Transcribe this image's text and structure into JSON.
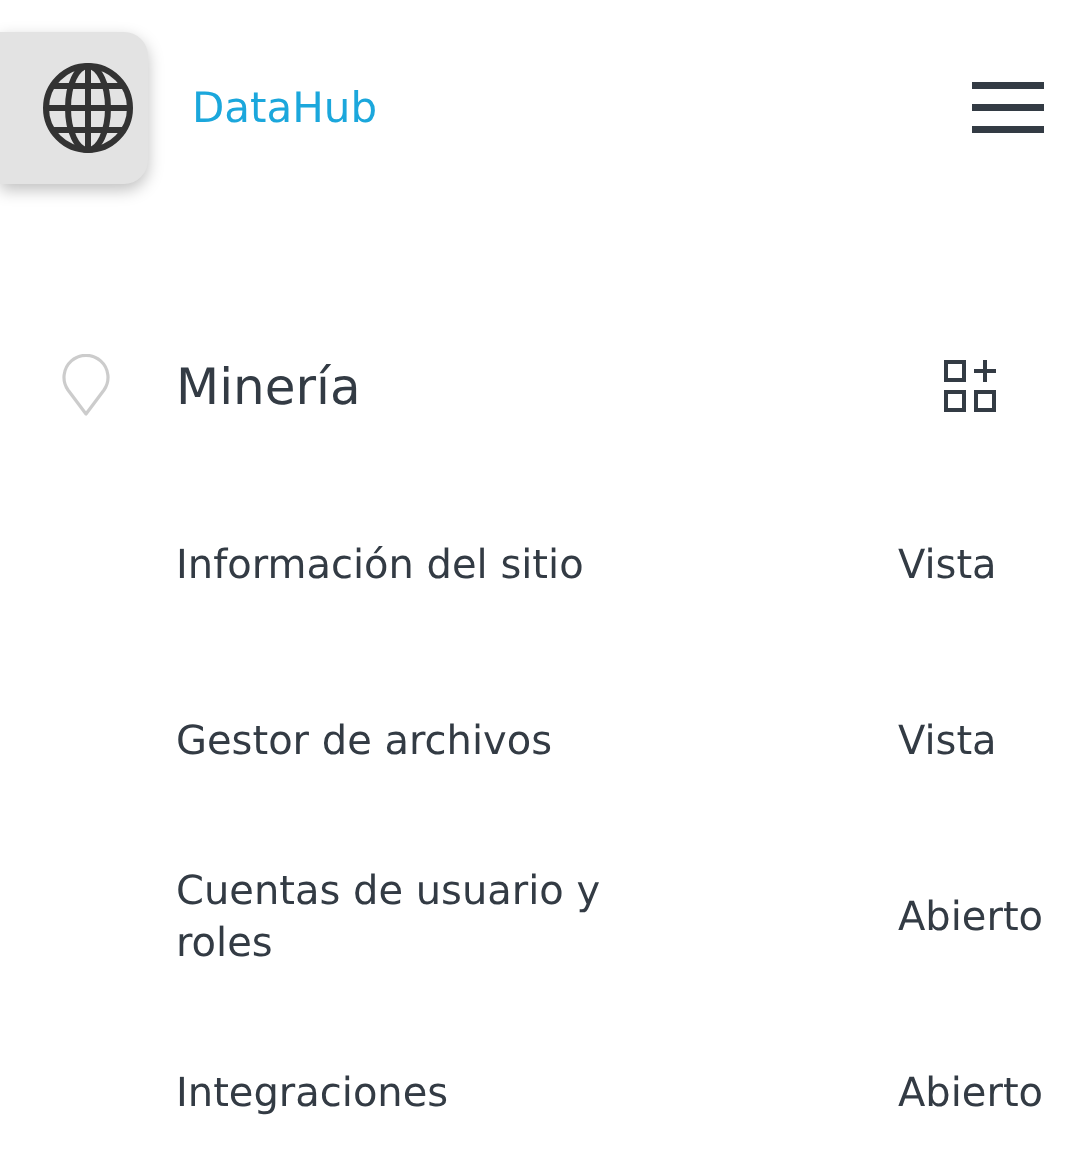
{
  "header": {
    "title": "DataHub"
  },
  "section": {
    "title": "Minería"
  },
  "items": [
    {
      "label": "Información del sitio",
      "value": "Vista"
    },
    {
      "label": "Gestor de archivos",
      "value": "Vista"
    },
    {
      "label": "Cuentas de usuario y roles",
      "value": "Abierto"
    },
    {
      "label": "Integraciones",
      "value": "Abierto"
    }
  ]
}
